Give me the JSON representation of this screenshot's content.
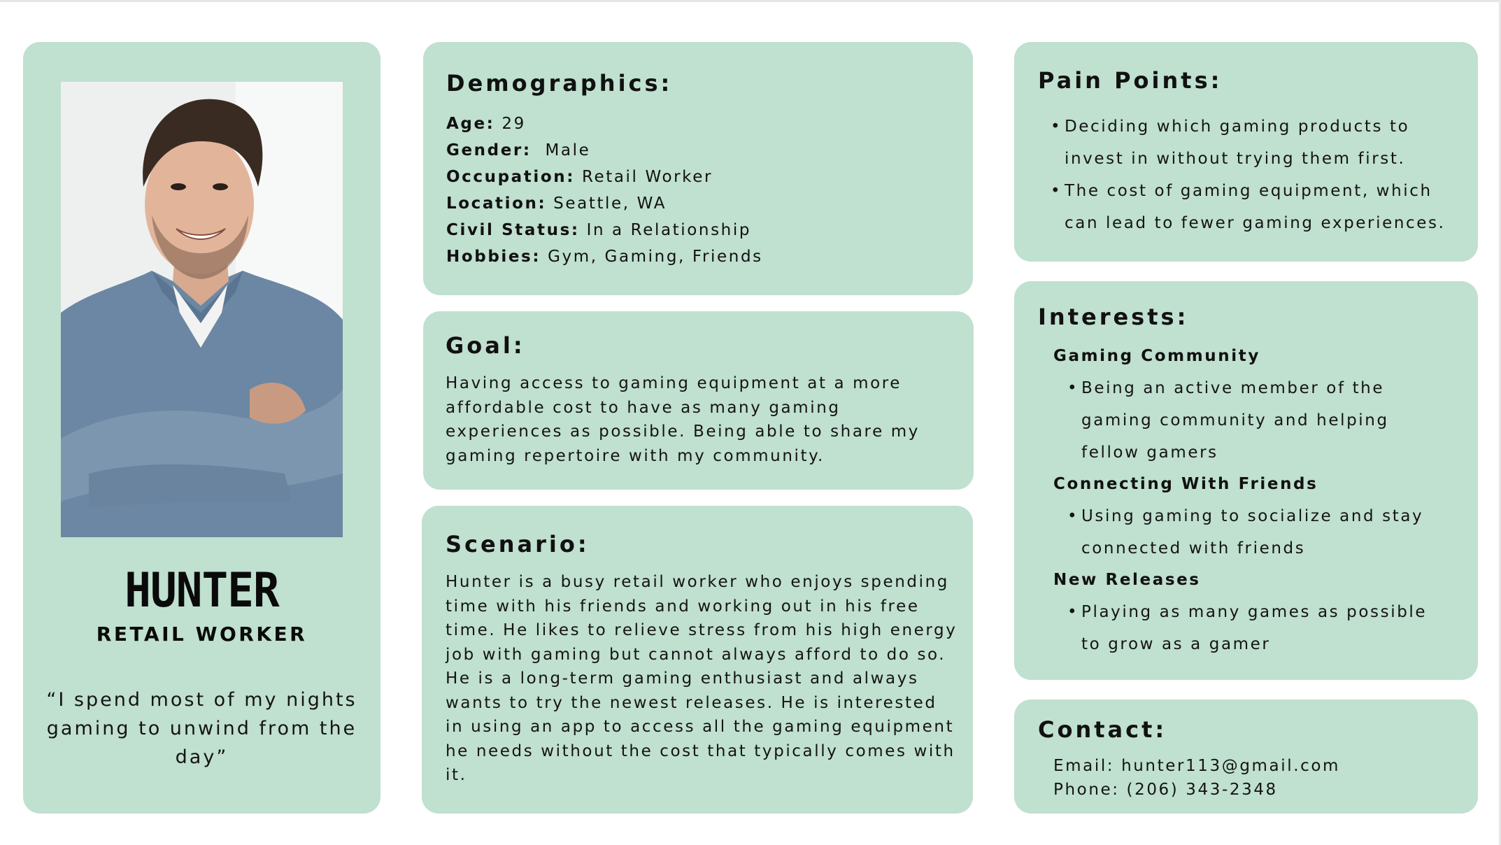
{
  "profile": {
    "name": "HUNTER",
    "role": "RETAIL WORKER",
    "quote": "“I spend most of my nights gaming to unwind from the day”"
  },
  "demographics": {
    "heading": "Demographics:",
    "rows": [
      {
        "label": "Age:",
        "value": " 29"
      },
      {
        "label": "Gender:",
        "value": "  Male"
      },
      {
        "label": "Occupation:",
        "value": " Retail Worker"
      },
      {
        "label": "Location:",
        "value": " Seattle, WA"
      },
      {
        "label": "Civil Status:",
        "value": " In a Relationship"
      },
      {
        "label": "Hobbies:",
        "value": " Gym, Gaming, Friends"
      }
    ]
  },
  "goal": {
    "heading": "Goal:",
    "text": "Having access to gaming equipment at a more affordable cost to have as many gaming experiences as possible. Being able to share my gaming repertoire with my community."
  },
  "scenario": {
    "heading": "Scenario:",
    "text": "Hunter is a busy retail worker who enjoys spending time with his friends and working out in his free time. He likes to relieve stress from his high energy job with gaming but cannot always afford to do so. He is a long-term gaming enthusiast and always wants to try the newest releases. He is interested in using an app to access all the gaming equipment he needs without the cost that typically comes with it."
  },
  "pain_points": {
    "heading": "Pain Points:",
    "items": [
      "Deciding which gaming products to invest in without trying them first.",
      "The cost of gaming equipment, which can lead to fewer gaming experiences."
    ]
  },
  "interests": {
    "heading": "Interests:",
    "groups": [
      {
        "title": "Gaming Community",
        "bullet": "Being an active member of the gaming community and helping fellow gamers"
      },
      {
        "title": "Connecting With Friends",
        "bullet": "Using gaming to socialize and stay connected with friends"
      },
      {
        "title": "New Releases",
        "bullet": "Playing as many games as possible to grow as a gamer"
      }
    ]
  },
  "contact": {
    "heading": "Contact:",
    "email": "Email: hunter113@gmail.com",
    "phone": "Phone: (206) 343-2348"
  },
  "colors": {
    "card": "#c0e0d0",
    "text": "#111111"
  }
}
